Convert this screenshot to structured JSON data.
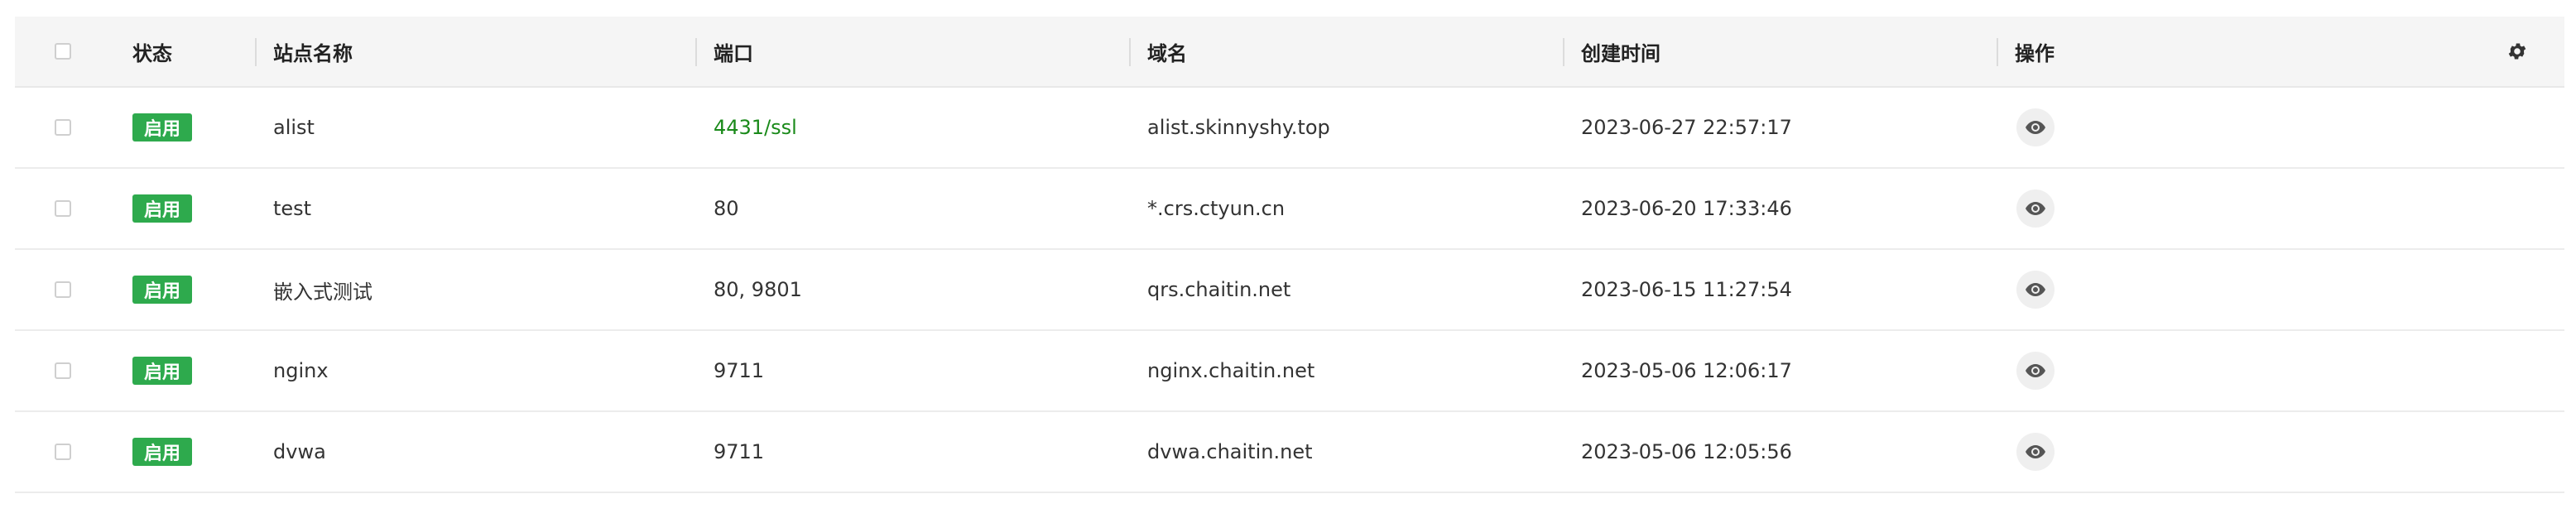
{
  "colors": {
    "badge_enabled": "#2eaa4d",
    "ssl_port": "#1a8a1a",
    "header_bg": "#f5f5f5"
  },
  "table": {
    "headers": {
      "status": "状态",
      "name": "站点名称",
      "port": "端口",
      "domain": "域名",
      "created": "创建时间",
      "operation": "操作"
    },
    "settings_icon": "gear-icon",
    "view_icon": "eye-icon",
    "rows": [
      {
        "status": "启用",
        "name": "alist",
        "port": "4431/ssl",
        "domain": "alist.skinnyshy.top",
        "created": "2023-06-27 22:57:17"
      },
      {
        "status": "启用",
        "name": "test",
        "port": "80",
        "domain": "*.crs.ctyun.cn",
        "created": "2023-06-20 17:33:46"
      },
      {
        "status": "启用",
        "name": "嵌入式测试",
        "port": "80, 9801",
        "domain": "qrs.chaitin.net",
        "created": "2023-06-15 11:27:54"
      },
      {
        "status": "启用",
        "name": "nginx",
        "port": "9711",
        "domain": "nginx.chaitin.net",
        "created": "2023-05-06 12:06:17"
      },
      {
        "status": "启用",
        "name": "dvwa",
        "port": "9711",
        "domain": "dvwa.chaitin.net",
        "created": "2023-05-06 12:05:56"
      }
    ]
  }
}
